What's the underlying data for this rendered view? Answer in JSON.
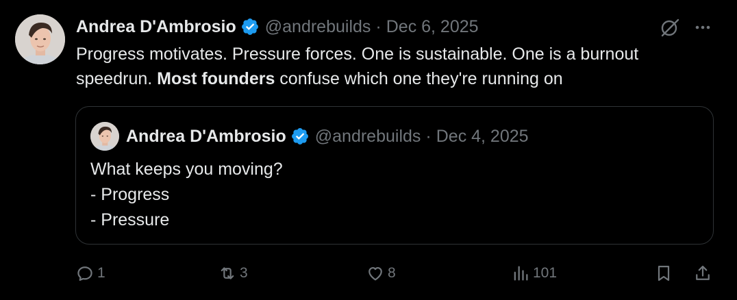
{
  "tweet": {
    "author_name": "Andrea D'Ambrosio",
    "handle": "@andrebuilds",
    "separator": "·",
    "date": "Dec 6, 2025",
    "text_part1": "Progress motivates. Pressure forces. One is sustainable. One is a burnout speedrun. ",
    "text_bold": "Most founders",
    "text_part2": " confuse which one they're running on",
    "verified": true
  },
  "quote": {
    "author_name": "Andrea D'Ambrosio",
    "handle": "@andrebuilds",
    "separator": "·",
    "date": "Dec 4, 2025",
    "lines": [
      "What keeps you moving?",
      "- Progress",
      "- Pressure"
    ]
  },
  "actions": {
    "replies": "1",
    "reposts": "3",
    "likes": "8",
    "views": "101"
  },
  "icons": {
    "verified": "verified-badge-icon",
    "grok": "grok-icon",
    "more": "more-icon",
    "reply": "reply-icon",
    "repost": "repost-icon",
    "like": "heart-icon",
    "views": "views-icon",
    "bookmark": "bookmark-icon",
    "share": "share-icon"
  },
  "colors": {
    "background": "#000000",
    "text": "#e7e9ea",
    "muted": "#71767b",
    "verified": "#1d9bf0",
    "border": "#2f3336"
  }
}
